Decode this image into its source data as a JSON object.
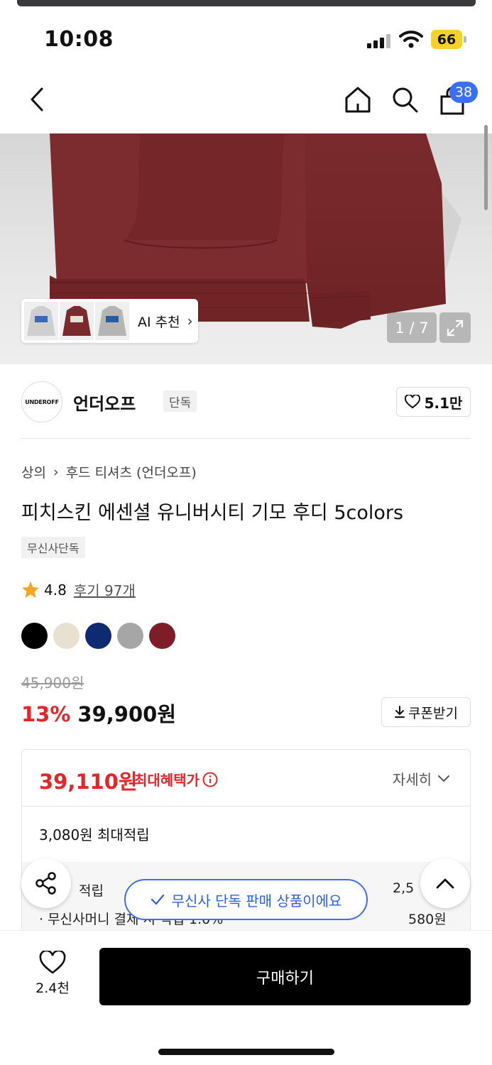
{
  "status_bar": {
    "time": "10:08",
    "battery": "66"
  },
  "nav": {
    "cart_count": "38"
  },
  "hero": {
    "ai_label": "AI 추천",
    "counter": "1 / 7"
  },
  "brand": {
    "logo_text": "UNDEROFF",
    "name": "언더오프",
    "tag": "단독",
    "likes": "5.1만"
  },
  "breadcrumb": [
    "상의",
    "후드 티셔츠 (언더오프)"
  ],
  "product": {
    "title": "피치스킨 에센셜 유니버시티 기모 후디 5colors",
    "tag": "무신사단독",
    "rating": "4.8",
    "reviews": "후기 97개",
    "colors": [
      "#000000",
      "#e8e1d2",
      "#0d2a73",
      "#a6a6a6",
      "#7e1c28"
    ],
    "original_price": "45,900원",
    "discount": "13%",
    "price": "39,900원",
    "coupon_label": "쿠폰받기"
  },
  "benefit": {
    "price": "39,110원",
    "label": "최대혜택가",
    "detail_label": "자세히",
    "max_points": "3,080원 최대적립",
    "line1_label": "적립",
    "line1_value": "2,5",
    "line2_label": "· 무신사머니 결제 시 적립 1.0%",
    "line2_value": "580원"
  },
  "toast": {
    "text": "무신사 단독 판매 상품이에요"
  },
  "bottom": {
    "wish_count": "2.4천",
    "buy_label": "구매하기"
  }
}
